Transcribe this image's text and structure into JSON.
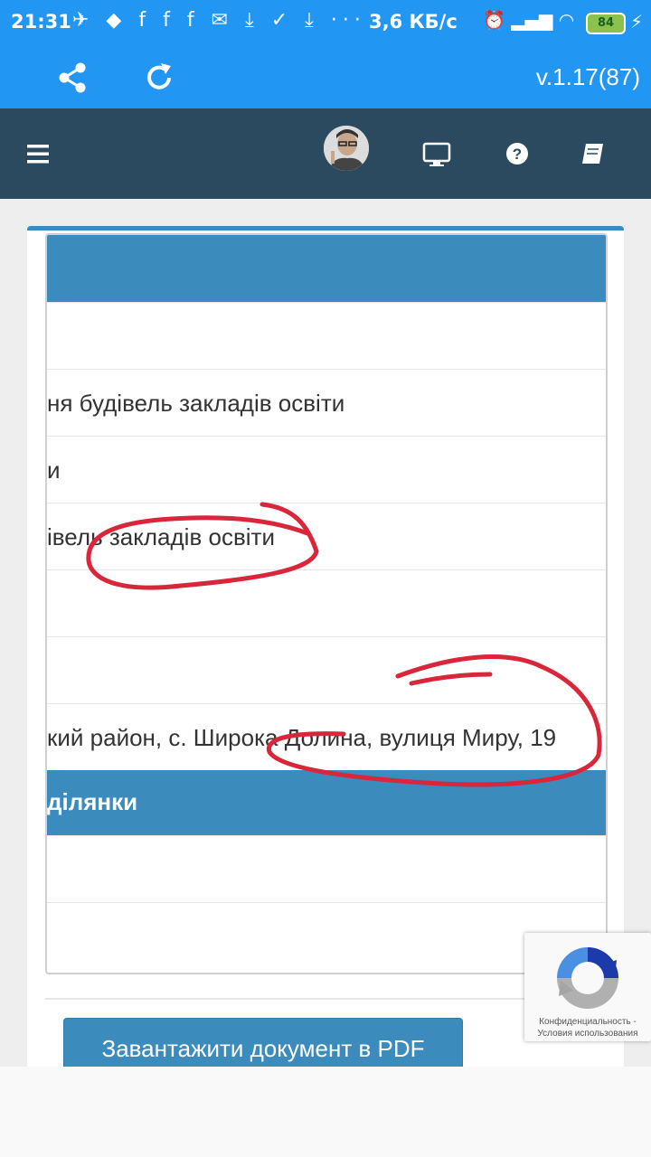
{
  "status_bar": {
    "time": "21:31",
    "speed": "3,6 КБ/с",
    "battery": "84"
  },
  "toolbar": {
    "version": "v.1.17(87)"
  },
  "table": {
    "row2": "ня будівель закладів освіти",
    "row3": "и",
    "row4": "івель закладів освіти",
    "row7": "кий район, с. Широка Долина, вулиця Миру, 19",
    "section_header": "ділянки"
  },
  "actions": {
    "pdf_button": "Завантажити документ в PDF"
  },
  "recaptcha": {
    "privacy": "Конфиденциальность",
    "terms": "Условия использования"
  },
  "colors": {
    "accent": "#2196f3",
    "nav": "#2b4a60",
    "table_header": "#3b8bbd",
    "annotation": "#d9263a"
  }
}
